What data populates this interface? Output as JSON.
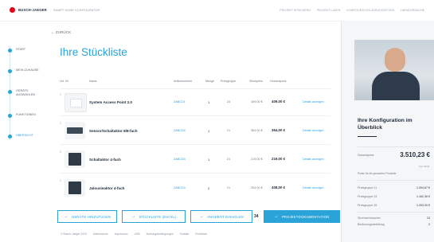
{
  "header": {
    "brand": "BUSCH-JAEGER",
    "product": "SMART HOME KONFIGURATOR",
    "nav": [
      "PROJEKT SPEICHERN",
      "PROJEKT LADEN",
      "KONFIGURATION ZURÜCKSETZEN",
      "HÄNDLERSUCHE"
    ]
  },
  "back_label": "ZURÜCK",
  "steps": [
    {
      "label": "START",
      "active": false
    },
    {
      "label": "MEIN ZUHAUSE",
      "active": false
    },
    {
      "label": "GERÄTE AUSWÄHLEN",
      "active": false
    },
    {
      "label": "FUNKTIONEN",
      "active": false
    },
    {
      "label": "ÜBERSICHT",
      "active": true
    }
  ],
  "page_title": "Ihre Stückliste",
  "table": {
    "headers": [
      "Lfd. Nr.",
      "Name",
      "Artikelnummer",
      "Menge",
      "Preisgruppe",
      "Stückpreis",
      "Gesamtpreis"
    ],
    "rows": [
      {
        "pos": "1",
        "name": "System Access Point 2.0",
        "art": "2ABCD1",
        "qty": "1",
        "ps": "24",
        "unit": "409,00 €",
        "total": "409,00 €",
        "detail": "Details anzeigen",
        "thumb": "white"
      },
      {
        "pos": "2",
        "name": "Sensor/Schaltaktor 8/8-fach",
        "art": "2ABCD2",
        "qty": "1",
        "ps": "21",
        "unit": "364,00 €",
        "total": "364,00 €",
        "detail": "Details anzeigen",
        "thumb": "dark"
      },
      {
        "pos": "3",
        "name": "Schaltaktor 4-fach",
        "art": "2ABCD3",
        "qty": "1",
        "ps": "21",
        "unit": "219,00 €",
        "total": "219,00 €",
        "detail": "Details anzeigen",
        "thumb": "darkbox"
      },
      {
        "pos": "4",
        "name": "Jalousieaktor 4-fach",
        "art": "2ABCD4",
        "qty": "2",
        "ps": "21",
        "unit": "204,00 €",
        "total": "408,00 €",
        "detail": "Details anzeigen",
        "thumb": "darkbox"
      }
    ]
  },
  "actions": {
    "add_devices": "GERÄTE HINZUFÜGEN",
    "export_list": "STÜCKLISTE (EXCEL)",
    "request_offer": "ANGEBOT EINHOLEN",
    "scroll_number": "34",
    "project_doc": "PROJEKTDOKUMENTATION"
  },
  "footer": [
    "© Busch-Jaeger 2020",
    "Datenschutz",
    "Impressum",
    "AGB",
    "Nutzungsbedingungen",
    "Kontakt",
    "Feedback"
  ],
  "summary": {
    "title": "Ihre Konfiguration im Überblick",
    "total_label": "Gesamtpreis",
    "total_value": "3.510,23 €",
    "total_note": "zzgl. MwSt.",
    "note": "Preise für die genannten Produkte",
    "groups": [
      {
        "label": "Preisgruppe 21",
        "value": "1.094,87 €"
      },
      {
        "label": "Preisgruppe 24",
        "value": "1.162,36 €"
      },
      {
        "label": "Preisgruppe 25",
        "value": "1.253,00 €"
      },
      {
        "label": "Stromverbraucher",
        "value": "24"
      },
      {
        "label": "Bedienungsanleitung",
        "value": "2"
      }
    ]
  }
}
